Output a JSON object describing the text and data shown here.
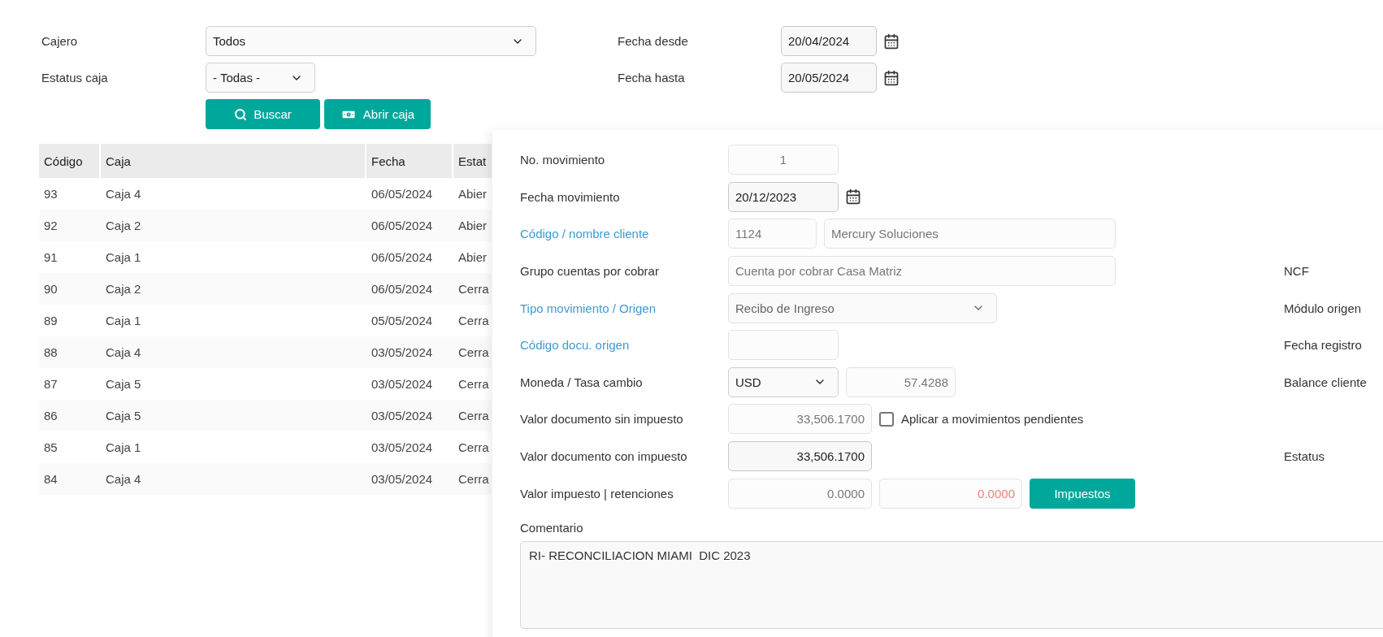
{
  "filters": {
    "rows": [
      {
        "label": "Cajero",
        "select": "Todos",
        "date_label": "Fecha desde",
        "date": "20/04/2024"
      },
      {
        "label": "Estatus caja",
        "select": "- Todas -",
        "date_label": "Fecha hasta",
        "date": "20/05/2024"
      }
    ],
    "buttons": [
      {
        "label": "Buscar",
        "kind": "search"
      },
      {
        "label": "Abrir caja",
        "kind": "cash"
      }
    ]
  },
  "table": {
    "columns": [
      "Código",
      "Caja",
      "Fecha",
      "Estat"
    ],
    "rows": [
      [
        "93",
        "Caja 4",
        "06/05/2024",
        "Abier"
      ],
      [
        "92",
        "Caja 2",
        "06/05/2024",
        "Abier"
      ],
      [
        "91",
        "Caja 1",
        "06/05/2024",
        "Abier"
      ],
      [
        "90",
        "Caja 2",
        "06/05/2024",
        "Cerra"
      ],
      [
        "89",
        "Caja 1",
        "05/05/2024",
        "Cerra"
      ],
      [
        "88",
        "Caja 4",
        "03/05/2024",
        "Cerra"
      ],
      [
        "87",
        "Caja 5",
        "03/05/2024",
        "Cerra"
      ],
      [
        "86",
        "Caja 5",
        "03/05/2024",
        "Cerra"
      ],
      [
        "85",
        "Caja 1",
        "03/05/2024",
        "Cerra"
      ],
      [
        "84",
        "Caja 4",
        "03/05/2024",
        "Cerra"
      ]
    ]
  },
  "form": {
    "rows": [
      {
        "label": "No. movimiento",
        "link": false,
        "controls": [
          {
            "kind": "input",
            "value": "1",
            "disabled": true
          }
        ]
      },
      {
        "label": "Fecha movimiento",
        "link": false,
        "controls": [
          {
            "kind": "date",
            "value": "20/12/2023",
            "disabled": false
          }
        ]
      },
      {
        "label": "Código / nombre cliente",
        "link": true,
        "controls": [
          {
            "kind": "input",
            "value": "1124",
            "disabled": true
          },
          {
            "kind": "input",
            "value": "Mercury Soluciones",
            "disabled": true
          }
        ]
      },
      {
        "label": "Grupo cuentas por cobrar",
        "link": false,
        "side_label": "NCF",
        "controls": [
          {
            "kind": "input",
            "value": "Cuenta por cobrar Casa Matriz",
            "disabled": true
          }
        ]
      },
      {
        "label": "Tipo movimiento / Origen",
        "link": true,
        "side_label": "Módulo origen",
        "controls": [
          {
            "kind": "select",
            "value": "Recibo de Ingreso",
            "disabled": true
          }
        ]
      },
      {
        "label": "Código docu. origen",
        "link": true,
        "side_label": "Fecha registro",
        "controls": [
          {
            "kind": "input",
            "disabled": true
          }
        ]
      },
      {
        "label": "Moneda / Tasa cambio",
        "link": false,
        "side_label": "Balance cliente",
        "controls": [
          {
            "kind": "select",
            "value": "USD",
            "disabled": false
          },
          {
            "kind": "input",
            "value": "57.4288",
            "disabled": true
          }
        ]
      },
      {
        "label": "Valor documento sin impuesto",
        "link": false,
        "controls": [
          {
            "kind": "input",
            "value": "33,506.1700",
            "disabled": true
          },
          {
            "kind": "checkbox",
            "value": "Aplicar a movimientos pendientes",
            "checked": false
          }
        ]
      },
      {
        "label": "Valor documento con impuesto",
        "link": false,
        "side_label": "Estatus",
        "controls": [
          {
            "kind": "input",
            "value": "33,506.1700",
            "disabled": false
          }
        ]
      },
      {
        "label": "Valor impuesto | retenciones",
        "link": false,
        "controls": [
          {
            "kind": "input",
            "value": "0.0000",
            "disabled": true
          },
          {
            "kind": "input",
            "value": "0.0000",
            "disabled": true,
            "alert": true
          },
          {
            "kind": "button",
            "value": "Impuestos"
          }
        ]
      }
    ],
    "comment_label": "Comentario",
    "comment": "RI- RECONCILIACION MIAMI  DIC 2023"
  }
}
